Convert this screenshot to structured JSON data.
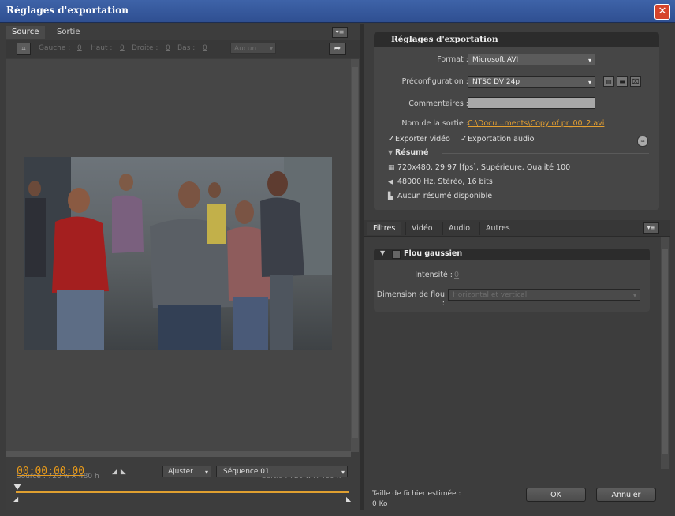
{
  "window": {
    "title": "Réglages d'exportation",
    "close_icon": "close-icon"
  },
  "left": {
    "tabs": [
      "Source",
      "Sortie"
    ],
    "crop": {
      "gauche_label": "Gauche :",
      "gauche_value": "0",
      "haut_label": "Haut :",
      "haut_value": "0",
      "droite_label": "Droite :",
      "droite_value": "0",
      "bas_label": "Bas :",
      "bas_value": "0",
      "ratio_value": "Aucun"
    },
    "source_dims": "Source : 720 w X 480 h",
    "output_dims": "Sortie : 720 w X 480 h",
    "timecode": "00:00:00:00",
    "fit_value": "Ajuster",
    "sequence_value": "Séquence 01"
  },
  "settings": {
    "title": "Réglages d'exportation",
    "format_label": "Format :",
    "format_value": "Microsoft AVI",
    "preset_label": "Préconfiguration :",
    "preset_value": "NTSC DV 24p",
    "comments_label": "Commentaires :",
    "comments_value": "",
    "output_name_label": "Nom de la sortie :",
    "output_name_value": "C:\\Docu...ments\\Copy of pr_00_2.avi",
    "export_video_label": "Exporter vidéo",
    "export_audio_label": "Exportation audio",
    "summary_title": "Résumé",
    "summary_video": "720x480, 29.97 [fps], Supérieure, Qualité 100",
    "summary_audio": "48000 Hz, Stéréo, 16 bits",
    "summary_none": "Aucun résumé disponible"
  },
  "filters": {
    "tabs": [
      "Filtres",
      "Vidéo",
      "Audio",
      "Autres"
    ],
    "filter_name": "Flou gaussien",
    "intensity_label": "Intensité :",
    "intensity_value": "0",
    "dimension_label": "Dimension de flou :",
    "dimension_value": "Horizontal et vertical"
  },
  "footer": {
    "estimate_label": "Taille de fichier estimée :",
    "estimate_value": "0 Ko",
    "ok_label": "OK",
    "cancel_label": "Annuler"
  },
  "colors": {
    "accent": "#e89a1a",
    "title_bar": "#3e63a8"
  }
}
